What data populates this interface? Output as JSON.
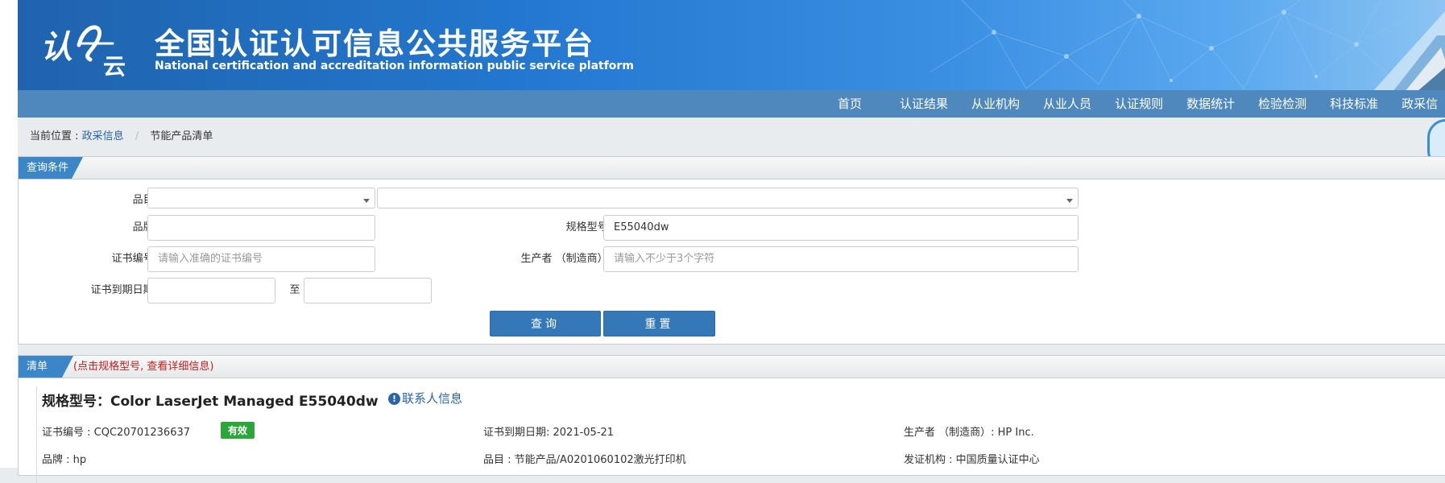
{
  "header": {
    "logo_text": "认e云",
    "title": "全国认证认可信息公共服务平台",
    "subtitle": "National certification and accreditation information public service platform",
    "bg_color": "#2377cf"
  },
  "nav": {
    "items": [
      "首页",
      "认证结果",
      "从业机构",
      "从业人员",
      "认证规则",
      "数据统计",
      "检验检测",
      "科技标准",
      "政采信"
    ]
  },
  "breadcrumb": {
    "prefix": "当前位置 :",
    "link": "政采信息",
    "separator": "/",
    "current": "节能产品清单"
  },
  "query_panel": {
    "tab_label": "查询条件",
    "category_label": "品目:",
    "category_select1": "",
    "category_select2": "",
    "brand_label": "品牌:",
    "brand_value": "",
    "model_label": "规格型号:",
    "model_value": "E55040dw",
    "cert_label": "证书编号:",
    "cert_placeholder": "请输入准确的证书编号",
    "maker_label": "生产者 （制造商）:",
    "maker_placeholder": "请输入不少于3个字符",
    "expiry_label": "证书到期日期:",
    "expiry_from": "",
    "to_label": "至",
    "expiry_to": "",
    "search_button": "查询",
    "reset_button": "重置"
  },
  "list_panel": {
    "tab_label": "清单",
    "hint": "(点击规格型号, 查看详细信息)",
    "results": [
      {
        "model_title": "规格型号：Color LaserJet Managed E55040dw",
        "contact_link": "联系人信息",
        "contact_icon": "info-icon",
        "cert_no": "证书编号 : CQC20701236637",
        "status": "有效",
        "status_color": "#2ca53a",
        "expiry": "证书到期日期: 2021-05-21",
        "maker": "生产者 （制造商）: HP Inc.",
        "brand": "品牌 : hp",
        "category": "品目 : 节能产品/A0201060102激光打印机",
        "issuer": "发证机构 : 中国质量认证中心"
      }
    ]
  },
  "colors": {
    "nav_bg": "#4f88bc",
    "tab_bg": "#3a86c8",
    "button_bg": "#3578b8",
    "link": "#2a64a8",
    "hint": "#c52020"
  }
}
